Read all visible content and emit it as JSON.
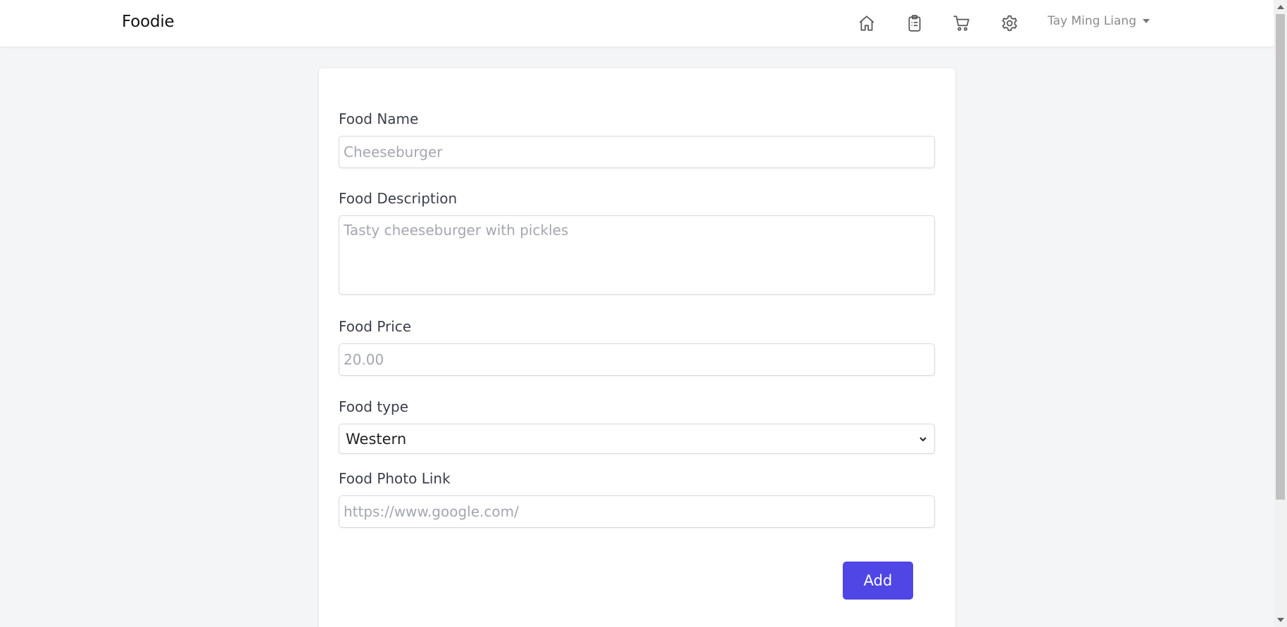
{
  "navbar": {
    "brand": "Foodie",
    "icons": [
      "home-icon",
      "clipboard-icon",
      "cart-icon",
      "settings-icon"
    ],
    "user_name": "Tay Ming Liang"
  },
  "form": {
    "food_name": {
      "label": "Food Name",
      "placeholder": "Cheeseburger",
      "value": ""
    },
    "food_description": {
      "label": "Food Description",
      "placeholder": "Tasty cheeseburger with pickles",
      "value": ""
    },
    "food_price": {
      "label": "Food Price",
      "placeholder": "20.00",
      "value": ""
    },
    "food_type": {
      "label": "Food type",
      "selected": "Western"
    },
    "food_photo_link": {
      "label": "Food Photo Link",
      "placeholder": "https://www.google.com/",
      "value": ""
    },
    "submit_label": "Add"
  },
  "colors": {
    "accent": "#4f46e5",
    "background": "#f4f5f7",
    "card": "#ffffff"
  }
}
